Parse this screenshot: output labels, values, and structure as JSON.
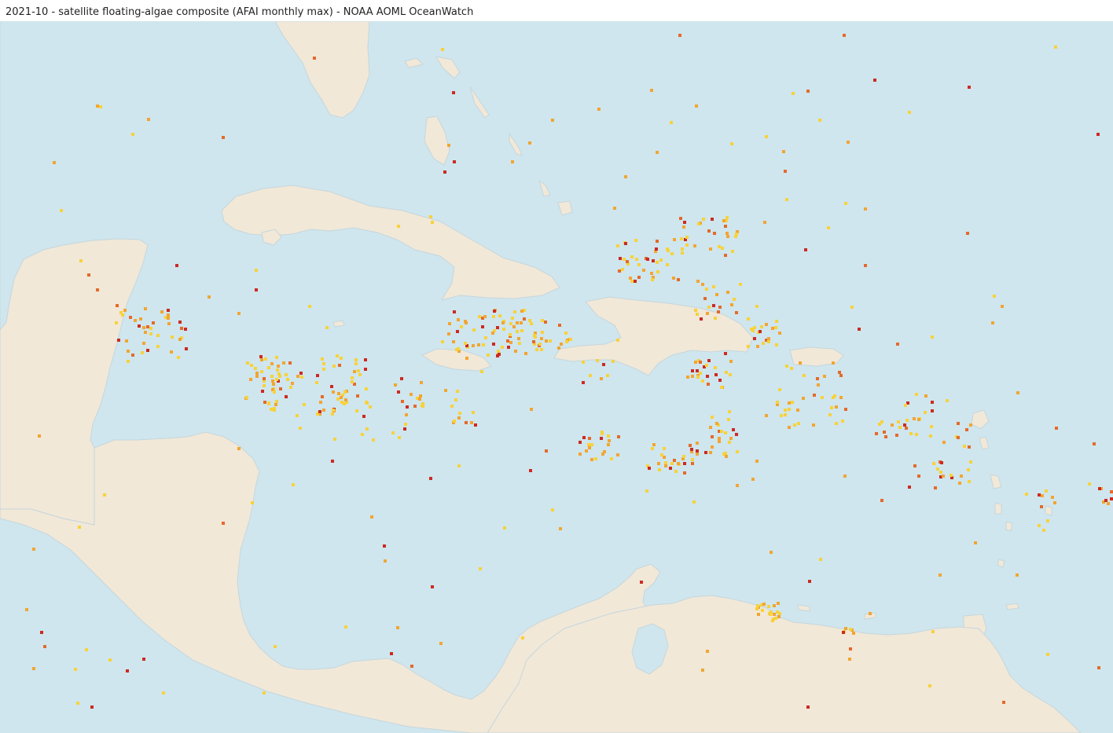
{
  "map": {
    "title": "2021-10 - satellite floating-algae composite (AFAI monthly max) - NOAA AOML OceanWatch",
    "ocean_color": "#cfe6ee",
    "land_color": "#f1e8d8",
    "coast_color": "#c6d6dc",
    "intensity_colors": {
      "low": "#f7d23a",
      "medium": "#f2a531",
      "high": "#e46a2a",
      "very_high": "#cc2a22"
    },
    "features": [
      "florida",
      "bahamas",
      "cuba",
      "jamaica",
      "hispaniola",
      "puerto-rico",
      "lesser-antilles",
      "yucatan",
      "central-america",
      "south-america"
    ]
  }
}
